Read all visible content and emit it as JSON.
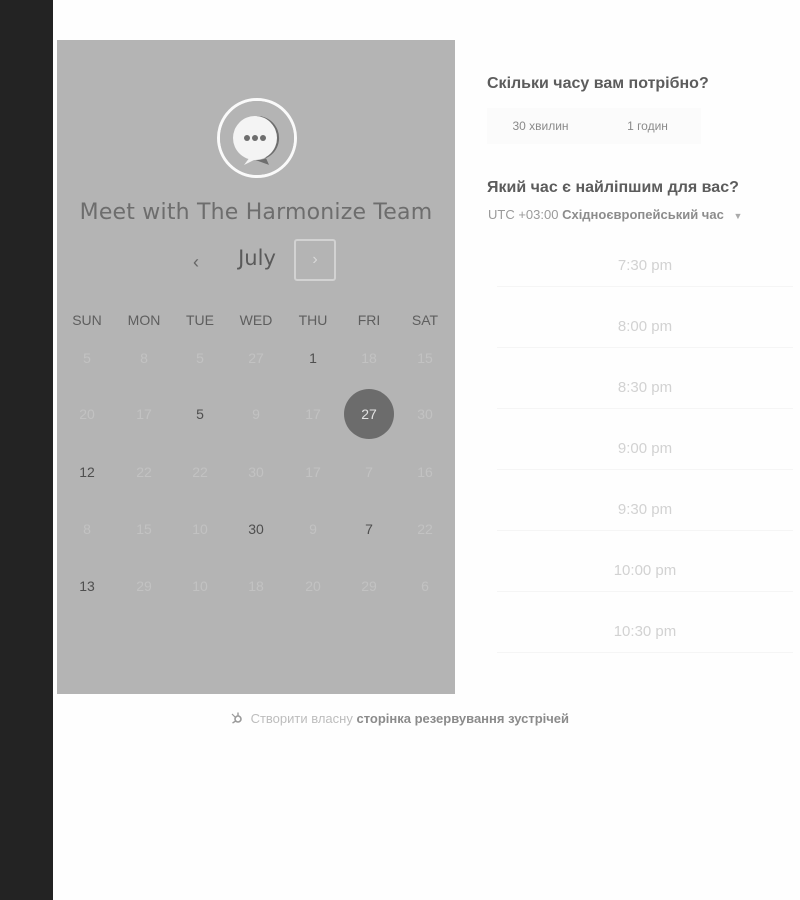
{
  "calendar": {
    "title": "Meet with The Harmonize Team",
    "month": "July",
    "prev_symbol": "‹",
    "next_symbol": "›",
    "weekdays": [
      "SUN",
      "MON",
      "TUE",
      "WED",
      "THU",
      "FRI",
      "SAT"
    ],
    "weeks": [
      [
        {
          "d": "5",
          "s": "off"
        },
        {
          "d": "8",
          "s": "off"
        },
        {
          "d": "5",
          "s": "off"
        },
        {
          "d": "27",
          "s": "off"
        },
        {
          "d": "1",
          "s": "on"
        },
        {
          "d": "18",
          "s": "off"
        },
        {
          "d": "15",
          "s": "off"
        }
      ],
      [
        {
          "d": "20",
          "s": "off"
        },
        {
          "d": "17",
          "s": "off"
        },
        {
          "d": "5",
          "s": "on"
        },
        {
          "d": "9",
          "s": "off"
        },
        {
          "d": "17",
          "s": "off"
        },
        {
          "d": "27",
          "s": "sel"
        },
        {
          "d": "30",
          "s": "off"
        }
      ],
      [
        {
          "d": "12",
          "s": "on"
        },
        {
          "d": "22",
          "s": "off"
        },
        {
          "d": "22",
          "s": "off"
        },
        {
          "d": "30",
          "s": "off"
        },
        {
          "d": "17",
          "s": "off"
        },
        {
          "d": "7",
          "s": "off"
        },
        {
          "d": "16",
          "s": "off"
        }
      ],
      [
        {
          "d": "8",
          "s": "off"
        },
        {
          "d": "15",
          "s": "off"
        },
        {
          "d": "10",
          "s": "off"
        },
        {
          "d": "30",
          "s": "on"
        },
        {
          "d": "9",
          "s": "off"
        },
        {
          "d": "7",
          "s": "on"
        },
        {
          "d": "22",
          "s": "off"
        }
      ],
      [
        {
          "d": "13",
          "s": "on"
        },
        {
          "d": "29",
          "s": "off"
        },
        {
          "d": "10",
          "s": "off"
        },
        {
          "d": "18",
          "s": "off"
        },
        {
          "d": "20",
          "s": "off"
        },
        {
          "d": "29",
          "s": "off"
        },
        {
          "d": "6",
          "s": "off"
        }
      ]
    ]
  },
  "duration": {
    "question": "Скільки часу вам потрібно?",
    "options": [
      "30 хвилин",
      "1 годин"
    ]
  },
  "time": {
    "question": "Який час є найліпшим для вас?",
    "tz_offset": "UTC +03:00",
    "tz_name": "Східноєвропейський час",
    "caret": "▼",
    "slots": [
      "7:30 pm",
      "8:00 pm",
      "8:30 pm",
      "9:00 pm",
      "9:30 pm",
      "10:00 pm",
      "10:30 pm"
    ]
  },
  "footer": {
    "prefix": "Створити власну",
    "link": "сторінка резервування зустрічей",
    "icon": "hubspot-sprocket-icon"
  }
}
